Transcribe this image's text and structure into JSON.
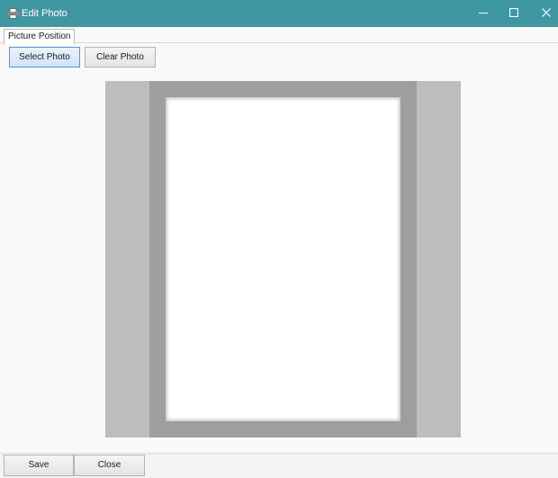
{
  "window": {
    "title": "Edit Photo",
    "icon": "printer-icon",
    "controls": [
      "minimize-icon",
      "maximize-icon",
      "close-icon"
    ],
    "titlebar_color": "#3f97a2"
  },
  "tabs": [
    {
      "label": "Picture Position",
      "selected": true
    }
  ],
  "toolbar": {
    "select_label": "Select Photo",
    "clear_label": "Clear Photo"
  },
  "footer": {
    "save_label": "Save",
    "close_label": "Close"
  }
}
